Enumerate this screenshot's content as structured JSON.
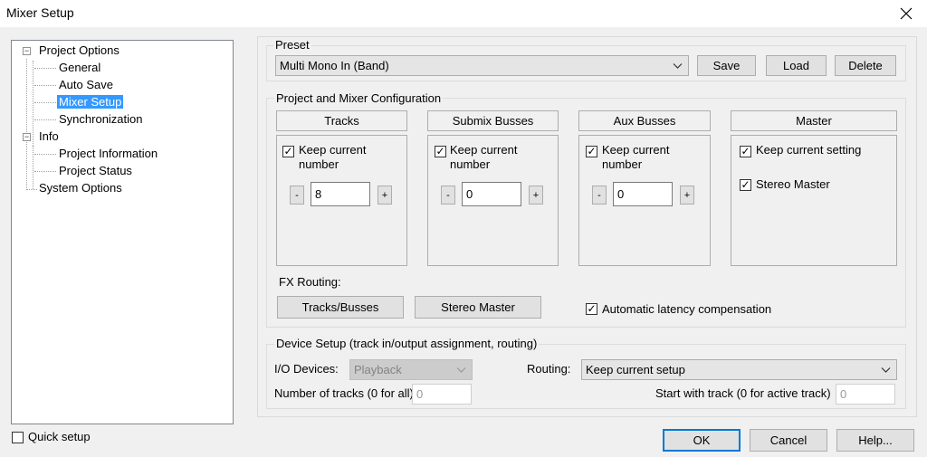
{
  "window": {
    "title": "Mixer Setup"
  },
  "tree": {
    "project_options": "Project Options",
    "general": "General",
    "auto_save": "Auto Save",
    "mixer_setup": "Mixer Setup",
    "synchronization": "Synchronization",
    "info": "Info",
    "project_information": "Project Information",
    "project_status": "Project Status",
    "system_options": "System Options",
    "expander_symbol": "−"
  },
  "preset": {
    "title": "Preset",
    "selected": "Multi Mono In (Band)",
    "save": "Save",
    "load": "Load",
    "delete": "Delete"
  },
  "config": {
    "title": "Project and Mixer Configuration",
    "tracks": {
      "header": "Tracks",
      "keep_line1": "Keep current",
      "keep_line2": "number",
      "value": "8",
      "checked": true
    },
    "submix": {
      "header": "Submix Busses",
      "keep_line1": "Keep current",
      "keep_line2": "number",
      "value": "0",
      "checked": true
    },
    "aux": {
      "header": "Aux Busses",
      "keep_line1": "Keep current",
      "keep_line2": "number",
      "value": "0",
      "checked": true
    },
    "master": {
      "header": "Master",
      "keep_setting": "Keep current setting",
      "stereo_master": "Stereo Master"
    },
    "minus": "-",
    "plus": "+",
    "fx_routing_label": "FX Routing:",
    "fx_tracks_busses": "Tracks/Busses",
    "fx_stereo_master": "Stereo Master",
    "auto_latency": "Automatic latency compensation"
  },
  "device": {
    "title": "Device Setup (track in/output assignment, routing)",
    "io_label": "I/O Devices:",
    "io_value": "Playback",
    "routing_label": "Routing:",
    "routing_value": "Keep current setup",
    "num_tracks_label": "Number of tracks (0 for all)",
    "num_tracks_value": "0",
    "start_label": "Start with track (0 for active track)",
    "start_value": "0"
  },
  "footer": {
    "quick_setup": "Quick setup",
    "ok": "OK",
    "cancel": "Cancel",
    "help": "Help..."
  },
  "check_mark": "✓"
}
